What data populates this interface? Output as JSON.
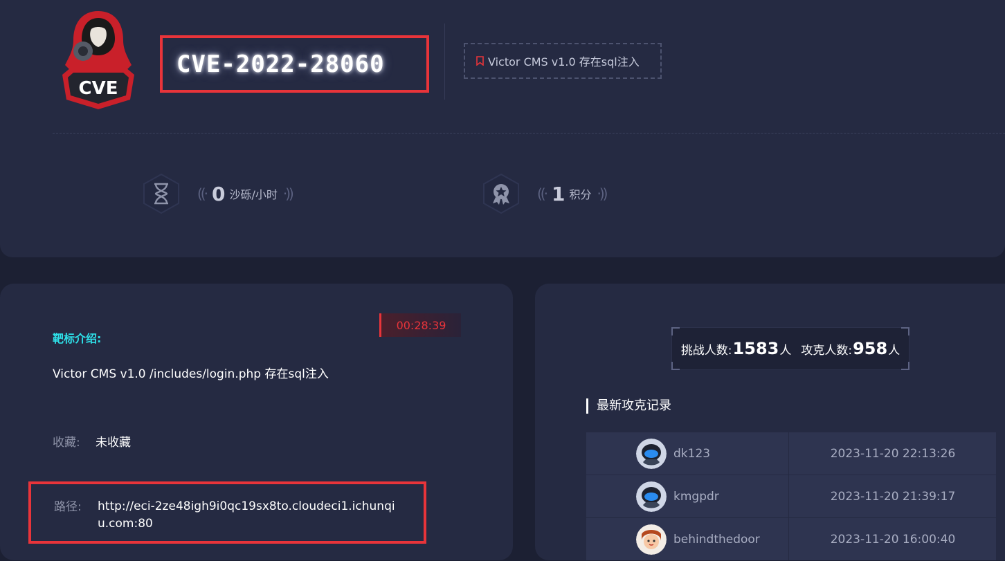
{
  "header": {
    "cve_id": "CVE-2022-28060",
    "logo_text": "CVE",
    "description_tag": "Victor CMS v1.0 存在sql注入",
    "bookmark_icon": "bookmark-icon",
    "stats": [
      {
        "icon": "hourglass-icon",
        "value": "0",
        "unit": "沙砾/小时"
      },
      {
        "icon": "medal-icon",
        "value": "1",
        "unit": "积分"
      }
    ]
  },
  "target": {
    "timer": "00:28:39",
    "intro_label": "靶标介绍:",
    "intro_text": "Victor CMS v1.0 /includes/login.php 存在sql注入",
    "favorite_label": "收藏:",
    "favorite_value": "未收藏",
    "path_label": "路径:",
    "path_value": "http://eci-2ze48igh9i0qc19sx8to.cloudeci1.ichunqiu.com:80"
  },
  "records": {
    "challengers_label": "挑战人数:",
    "challengers_count": "1583",
    "challengers_unit": "人",
    "solvers_label": "攻克人数:",
    "solvers_count": "958",
    "solvers_unit": "人",
    "title": "最新攻克记录",
    "rows": [
      {
        "avatar": "robot-avatar",
        "user": "dk123",
        "time": "2023-11-20 22:13:26"
      },
      {
        "avatar": "robot-avatar",
        "user": "kmgpdr",
        "time": "2023-11-20 21:39:17"
      },
      {
        "avatar": "girl-avatar",
        "user": "behindthedoor",
        "time": "2023-11-20 16:00:40"
      }
    ]
  },
  "colors": {
    "accent_red": "#e8343a",
    "accent_cyan": "#2ee0e8",
    "card_bg": "#252a42",
    "page_bg": "#1c2033"
  }
}
